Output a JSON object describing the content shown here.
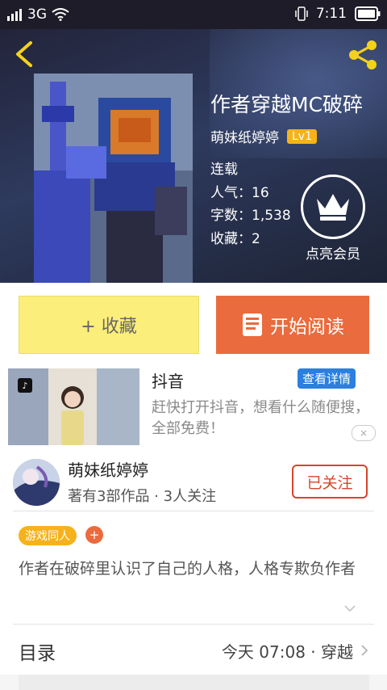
{
  "status_bar": {
    "network": "3G",
    "time": "7:11"
  },
  "book": {
    "title": "作者穿越MC破碎",
    "author": "萌妹纸婷婷",
    "author_level": "Lv1",
    "status": "连载",
    "popularity": "人气：16",
    "word_count": "字数：1,538",
    "favorites": "收藏：2"
  },
  "vip": {
    "label": "点亮会员"
  },
  "actions": {
    "collect_label": "+ 收藏",
    "read_label": "开始阅读"
  },
  "ad": {
    "name": "抖音",
    "detail_label": "查看详情",
    "description": "赶快打开抖音，想看什么随便搜，全部免费！",
    "close_label": "×"
  },
  "author_card": {
    "name": "萌妹纸婷婷",
    "works": "著有3部作品 · 3人关注",
    "follow_label": "已关注"
  },
  "tags": {
    "primary": "游戏同人",
    "add_label": "+"
  },
  "description": "作者在破碎里认识了自己的人格，人格专欺负作者",
  "toc": {
    "label": "目录",
    "latest": "今天 07:08 · 穿越"
  },
  "colors": {
    "accent_orange": "#e96b3e",
    "collect_yellow": "#fcee7a",
    "level_badge": "#f6b21a",
    "follow_red": "#d9442a",
    "ad_blue": "#2a7fe0"
  }
}
